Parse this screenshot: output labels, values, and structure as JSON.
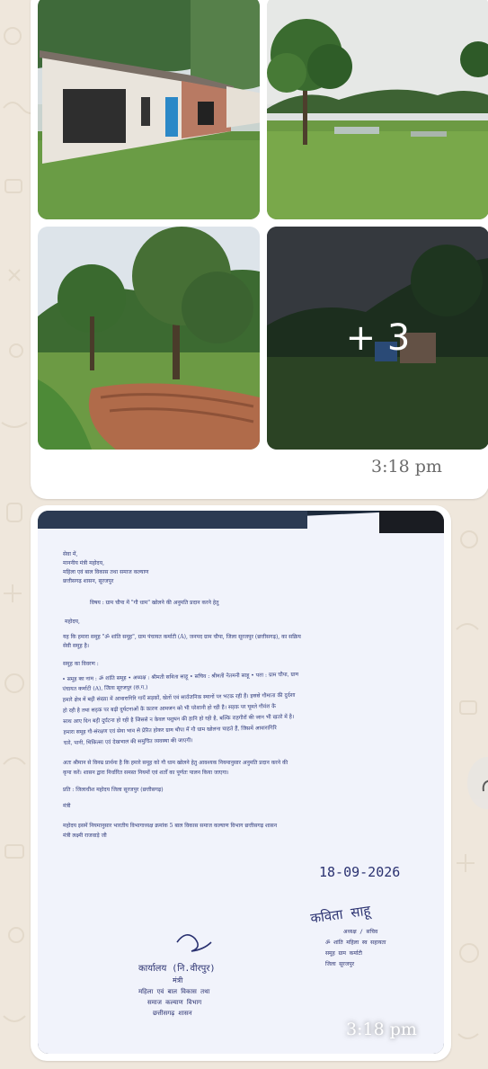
{
  "message_album": {
    "more_count": "+ 3",
    "time": "3:18 pm"
  },
  "message_document": {
    "time": "3:18 pm",
    "date": "18-09-2026",
    "doc": {
      "addressee": [
        "सेवा में,",
        "माननीय मंत्री महोदय,",
        "महिला एवं बाल विकास तथा समाज कल्याण",
        "छत्तीसगढ़ शासन, सूरजपुर"
      ],
      "subject": "विषय : ग्राम चौपा में \"गौ धाम\" खोलने की अनुमति प्रदान करने हेतु",
      "salutation": "महोदय,",
      "para1": [
        "यह कि हमारा समूह \"ॐ शांति समूह\", ग्राम पंचायत कर्माटी (A), जनपद ग्राम चौपा, जिला सूरजपुर (छत्तीसगढ़), का सक्रिय",
        "सेवी समूह है।"
      ],
      "details_title": "समूह का विवरण :",
      "para2": [
        "• समूह का नाम : ॐ शांति समूह • अध्यक्ष : श्रीमती सविता साहू • सचिव : श्रीमती नेतमनी साहू • पता : ग्राम चौपा, ग्राम",
        "पंचायत कर्माटी (A), जिला सूरजपुर (छ.ग.)",
        "हमारे क्षेत्र में बड़ी संख्या में आवारागिरि गायें सड़कों, खेतों एवं सार्वजनिक स्थानों पर भटक रही हैं। इससे गौमाता की दुर्दशा",
        "हो रही है तथा सड़क पर बढ़ी दुर्घटनाओं के कारण आमजन को भी परेशानी हो रही है। सड़क पर घूमते गौवंश के",
        "साथ आए दिन बड़ी दुर्घटना हो रही है जिससे न केवल पशुधन की हानि हो रही है, बल्कि राहगीरों की जान भी खतरे में है।",
        "हमारा समूह गौ-संरक्षण एवं सेवा भाव से प्रेरित होकर ग्राम चौपा में गौ धाम खोलना चाहते हैं, जिसमें आवारागिरि",
        "चारे, पानी, चिकित्सा एवं देखभाल की समुचित व्यवस्था की जाएगी।"
      ],
      "para3": [
        "अतः श्रीमान से विनम्र प्रार्थना है कि हमारे समूह को गौ धाम खोलने हेतु आवश्यक नियमानुसार अनुमति प्रदान करने की",
        "कृपा करें। शासन द्वारा निर्धारित समस्त नियमों एवं शर्तों का पूर्णतः पालन किया जाएगा।"
      ],
      "copy": "प्रति : जिलाधीश महोदय जिला सूरजपुर (छत्तीसगढ़)",
      "minister_label": "मंत्री",
      "forward": [
        "महोदय इसमें नियमानुसार भारतीय विभागाध्यक्ष क्रमांक 5 बाल विकास समाज कल्याण विभाग छत्तीसगढ़ शासन",
        "मंत्री लक्ष्मी राजवाड़े जी"
      ],
      "sign_right": "कविता साहू",
      "stamp_right": [
        "अध्यक्ष / सचिव",
        "ॐ शांति महिला स्व सहायता",
        "समूह ग्राम कर्माटी",
        "जिला सूरजपुर"
      ],
      "stamp_left": [
        "कार्यालय (नि.वीरपुर)",
        "मंत्री",
        "महिला एवं बाल विकास तथा",
        "समाज कल्याण विभाग",
        "छत्तीसगढ़ शासन"
      ]
    }
  },
  "colors": {
    "wallpaper": "#efe7dc",
    "bubble": "#ffffff",
    "paper": "#f1f3fb",
    "ink": "#2e3a7a"
  }
}
